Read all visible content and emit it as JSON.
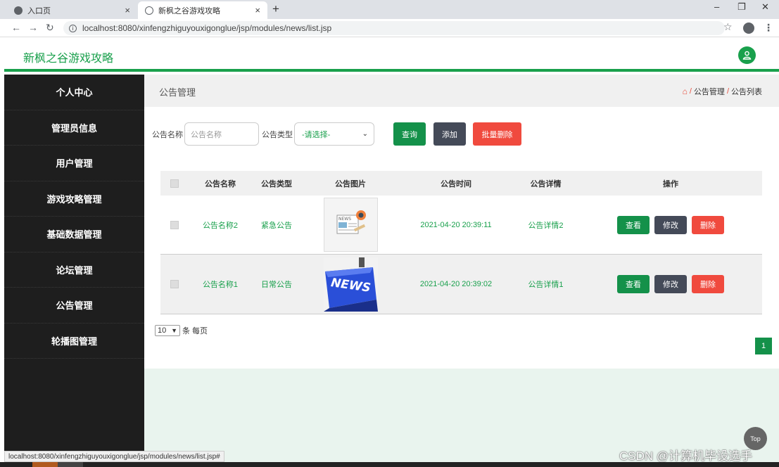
{
  "browser": {
    "tabs": [
      {
        "label": "入口页",
        "close": "×"
      },
      {
        "label": "新枫之谷游戏攻略",
        "close": "×"
      }
    ],
    "new_tab": "+",
    "url": "localhost:8080/xinfengzhiguyouxigonglue/jsp/modules/news/list.jsp",
    "status_url": "localhost:8080/xinfengzhiguyouxigonglue/jsp/modules/news/list.jsp#"
  },
  "header": {
    "title": "新枫之谷游戏攻略"
  },
  "sidebar": {
    "items": [
      {
        "label": "个人中心"
      },
      {
        "label": "管理员信息"
      },
      {
        "label": "用户管理"
      },
      {
        "label": "游戏攻略管理"
      },
      {
        "label": "基础数据管理"
      },
      {
        "label": "论坛管理"
      },
      {
        "label": "公告管理"
      },
      {
        "label": "轮播图管理"
      }
    ]
  },
  "page": {
    "title": "公告管理",
    "breadcrumb": {
      "sep": "/",
      "level1": "公告管理",
      "level2": "公告列表"
    }
  },
  "search": {
    "name_label": "公告名称",
    "name_placeholder": "公告名称",
    "type_label": "公告类型",
    "type_selected": "-请选择-",
    "query_btn": "查询",
    "add_btn": "添加",
    "batch_delete_btn": "批量删除"
  },
  "table": {
    "headers": {
      "name": "公告名称",
      "type": "公告类型",
      "image": "公告图片",
      "time": "公告时间",
      "detail": "公告详情",
      "actions": "操作"
    },
    "rows": [
      {
        "name": "公告名称2",
        "type": "紧急公告",
        "time": "2021-04-20 20:39:11",
        "detail": "公告详情2",
        "image_text": "NEWS"
      },
      {
        "name": "公告名称1",
        "type": "日常公告",
        "time": "2021-04-20 20:39:02",
        "detail": "公告详情1",
        "image_text": "NEWS"
      }
    ],
    "actions": {
      "view": "查看",
      "edit": "修改",
      "delete": "删除"
    }
  },
  "pagination": {
    "page_size": "10",
    "per_page_text": "条 每页",
    "current_page": "1"
  },
  "top_button": "Top",
  "watermark": "CSDN @计算机毕设选手",
  "colors": {
    "brand": "#19a04c",
    "sidebar": "#1e1e1e",
    "danger": "#f04a3e",
    "dark": "#444a58"
  }
}
